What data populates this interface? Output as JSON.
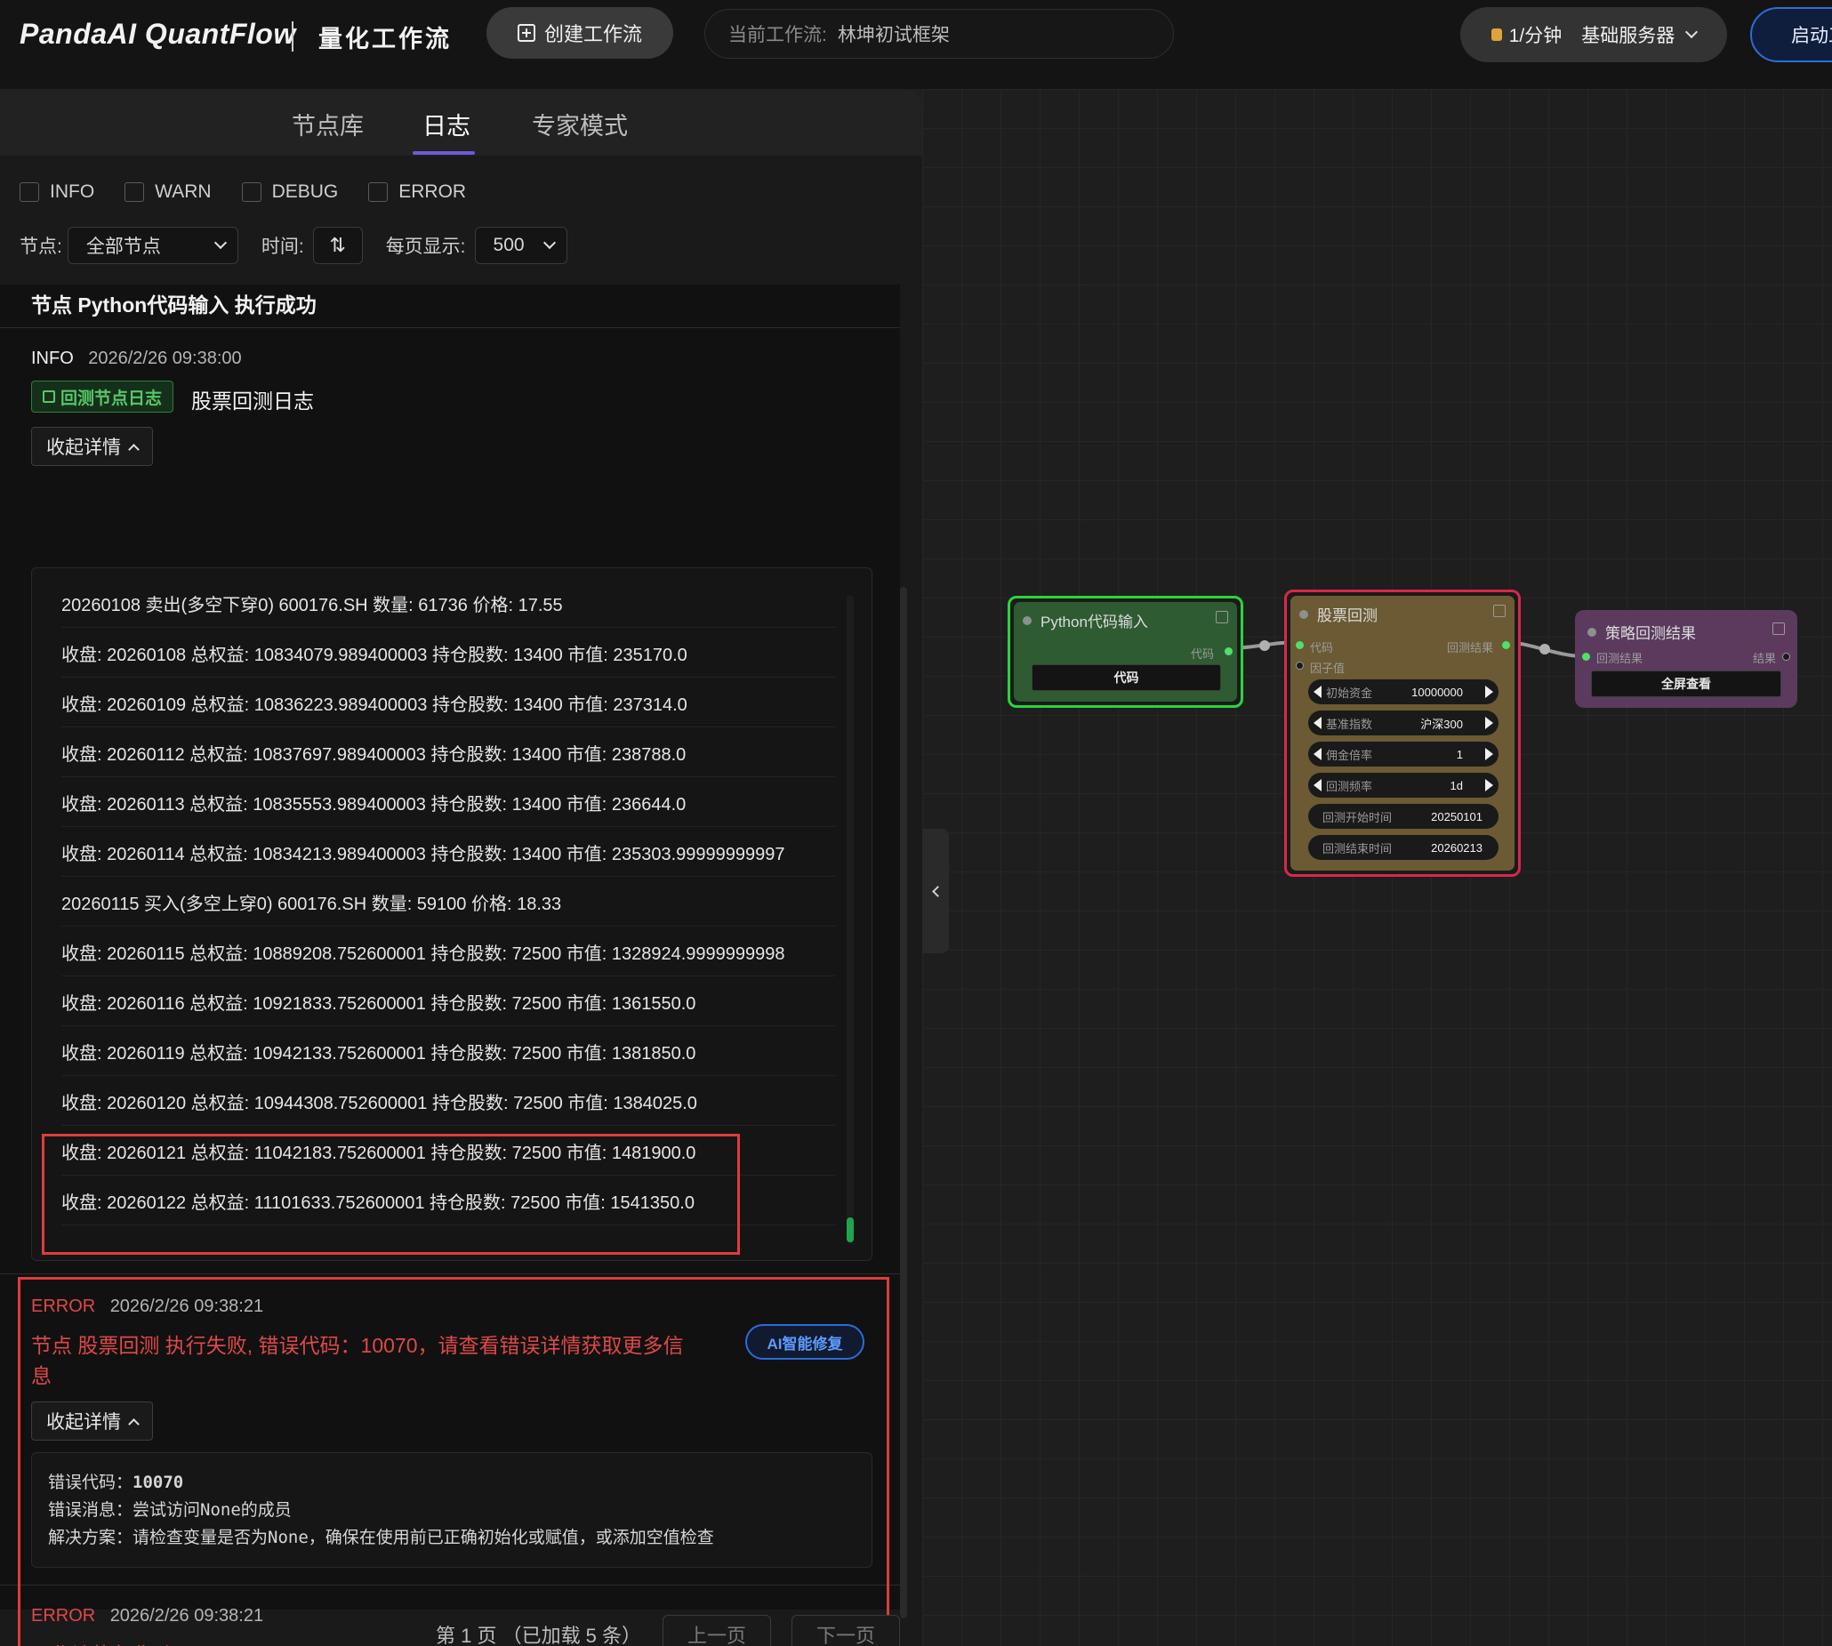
{
  "header": {
    "brand": "PandaAI QuantFlow",
    "subtitle": "量化工作流",
    "create_label": "创建工作流",
    "workflow_label": "当前工作流:",
    "workflow_name": "林坤初试框架",
    "server_rate": "1/分钟",
    "server_name": "基础服务器",
    "start_label": "启动工"
  },
  "tabs": [
    {
      "label": "节点库",
      "active": false
    },
    {
      "label": "日志",
      "active": true
    },
    {
      "label": "专家模式",
      "active": false
    }
  ],
  "filters": {
    "levels": [
      "INFO",
      "WARN",
      "DEBUG",
      "ERROR"
    ],
    "node_label": "节点:",
    "node_value": "全部节点",
    "time_label": "时间:",
    "page_size_label": "每页显示:",
    "page_size_value": "500"
  },
  "log": {
    "top_entry_title": "节点 Python代码输入 执行成功",
    "entry1": {
      "level": "INFO",
      "timestamp": "2026/2/26 09:38:00",
      "badge": "回测节点日志",
      "title": "股票回测日志",
      "collapse_label": "收起详情",
      "lines": [
        "20260108 卖出(多空下穿0) 600176.SH 数量: 61736 价格: 17.55",
        "收盘: 20260108 总权益: 10834079.989400003 持仓股数: 13400 市值: 235170.0",
        "收盘: 20260109 总权益: 10836223.989400003 持仓股数: 13400 市值: 237314.0",
        "收盘: 20260112 总权益: 10837697.989400003 持仓股数: 13400 市值: 238788.0",
        "收盘: 20260113 总权益: 10835553.989400003 持仓股数: 13400 市值: 236644.0",
        "收盘: 20260114 总权益: 10834213.989400003 持仓股数: 13400 市值: 235303.99999999997",
        "20260115 买入(多空上穿0) 600176.SH 数量: 59100 价格: 18.33",
        "收盘: 20260115 总权益: 10889208.752600001 持仓股数: 72500 市值: 1328924.9999999998",
        "收盘: 20260116 总权益: 10921833.752600001 持仓股数: 72500 市值: 1361550.0",
        "收盘: 20260119 总权益: 10942133.752600001 持仓股数: 72500 市值: 1381850.0",
        "收盘: 20260120 总权益: 10944308.752600001 持仓股数: 72500 市值: 1384025.0",
        "收盘: 20260121 总权益: 11042183.752600001 持仓股数: 72500 市值: 1481900.0",
        "收盘: 20260122 总权益: 11101633.752600001 持仓股数: 72500 市值: 1541350.0"
      ]
    },
    "entry2": {
      "level": "ERROR",
      "timestamp": "2026/2/26 09:38:21",
      "message_line1": "节点 股票回测 执行失败, 错误代码：10070，请查看错误详情获取更多信",
      "message_line2": "息",
      "ai_fix_label": "AI智能修复",
      "collapse_label": "收起详情",
      "code_label": "错误代码：",
      "code_value": "10070",
      "msg_label": "错误消息：",
      "msg_value": "尝试访问None的成员",
      "fix_label": "解决方案：",
      "fix_value": "请检查变量是否为None，确保在使用前已正确初始化或赋值，或添加空值检查"
    },
    "entry3": {
      "level": "ERROR",
      "timestamp": "2026/2/26 09:38:21",
      "message": "工作流执行失败"
    },
    "pager_text": "第 1 页 （已加载 5 条）",
    "prev_label": "上一页",
    "next_label": "下一页"
  },
  "nodes": {
    "python": {
      "title": "Python代码输入",
      "out_port": "代码",
      "button": "代码",
      "color": "#2f5b33"
    },
    "backtest": {
      "title": "股票回测",
      "in_ports": [
        "代码",
        "因子值"
      ],
      "out_port": "回测结果",
      "params": [
        {
          "label": "初始资金",
          "value": "10000000"
        },
        {
          "label": "基准指数",
          "value": "沪深300"
        },
        {
          "label": "佣金倍率",
          "value": "1"
        },
        {
          "label": "回测频率",
          "value": "1d"
        },
        {
          "label": "回测开始时间",
          "value": "20250101"
        },
        {
          "label": "回测结束时间",
          "value": "20260213"
        }
      ],
      "color": "#6b5a33"
    },
    "result": {
      "title": "策略回测结果",
      "in_port": "回测结果",
      "out_port": "结果",
      "button": "全屏查看",
      "color": "#5b3a5e"
    }
  },
  "colors": {
    "error": "#e04848",
    "highlight": "#e03b3b",
    "accent": "#6b5bd6",
    "success": "#58c66a"
  }
}
